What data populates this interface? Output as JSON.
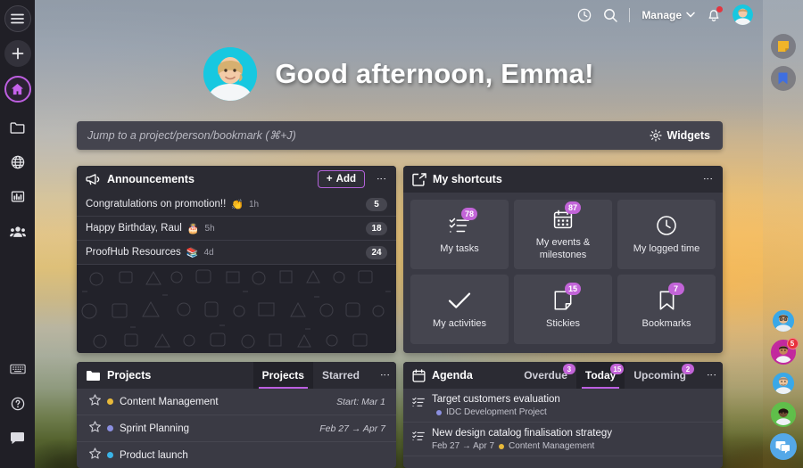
{
  "header": {
    "clock_icon": "clock-icon",
    "search_icon": "search-icon",
    "manage_label": "Manage",
    "chevron_icon": "chevron-down-icon",
    "bell_icon": "bell-icon",
    "avatar": "user-avatar"
  },
  "greeting": {
    "text": "Good afternoon, Emma!",
    "avatar": "emma-avatar"
  },
  "jumpbar": {
    "placeholder": "Jump to a project/person/bookmark (⌘+J)",
    "value": "",
    "widgets_label": "Widgets",
    "widgets_icon": "gear-icon"
  },
  "left_rail": {
    "items": [
      {
        "name": "menu-icon",
        "icon": "hamburger"
      },
      {
        "name": "add-icon",
        "icon": "plus"
      },
      {
        "name": "home-icon",
        "icon": "home",
        "active": true
      },
      {
        "name": "folder-icon",
        "icon": "folder"
      },
      {
        "name": "globe-icon",
        "icon": "globe"
      },
      {
        "name": "reports-icon",
        "icon": "chart"
      },
      {
        "name": "people-icon",
        "icon": "people"
      }
    ],
    "bottom_items": [
      {
        "name": "keyboard-icon",
        "icon": "keyboard"
      },
      {
        "name": "help-icon",
        "icon": "question"
      },
      {
        "name": "chat-icon",
        "icon": "chat"
      }
    ]
  },
  "right_rail": {
    "buttons": [
      {
        "name": "stickies-icon",
        "color": "#f0b429"
      },
      {
        "name": "bookmarks-icon",
        "color": "#3f6fe0"
      }
    ],
    "avatars": [
      {
        "name": "teammate-avatar-1",
        "ring": "none",
        "badge": ""
      },
      {
        "name": "teammate-avatar-2",
        "ring": "#c2289e",
        "badge": "5"
      },
      {
        "name": "teammate-avatar-3",
        "ring": "none",
        "badge": ""
      },
      {
        "name": "teammate-avatar-4",
        "ring": "#5fbf4a",
        "badge": ""
      }
    ],
    "chat_fab": "chat-bubble-icon"
  },
  "announcements": {
    "title": "Announcements",
    "icon": "megaphone-icon",
    "add_label": "Add",
    "menu_icon": "kebab-menu-icon",
    "rows": [
      {
        "text": "Congratulations on promotion!!",
        "emoji": "👏",
        "time": "1h",
        "count": "5"
      },
      {
        "text": "Happy Birthday, Raul",
        "emoji": "🎂",
        "time": "5h",
        "count": "18"
      },
      {
        "text": "ProofHub Resources",
        "emoji": "📚",
        "time": "4d",
        "count": "24"
      }
    ]
  },
  "shortcuts": {
    "title": "My shortcuts",
    "icon": "share-box-icon",
    "menu_icon": "kebab-menu-icon",
    "tiles": [
      {
        "label": "My tasks",
        "badge": "78",
        "icon": "checklist-icon"
      },
      {
        "label": "My events & milestones",
        "badge": "87",
        "icon": "calendar-icon"
      },
      {
        "label": "My logged time",
        "badge": "",
        "icon": "clock-icon"
      },
      {
        "label": "My activities",
        "badge": "",
        "icon": "check-icon"
      },
      {
        "label": "Stickies",
        "badge": "15",
        "icon": "note-icon"
      },
      {
        "label": "Bookmarks",
        "badge": "7",
        "icon": "bookmark-icon"
      }
    ]
  },
  "projects": {
    "title": "Projects",
    "icon": "folder-icon",
    "menu_icon": "kebab-menu-icon",
    "tabs": [
      {
        "label": "Projects",
        "active": true
      },
      {
        "label": "Starred",
        "active": false
      }
    ],
    "rows": [
      {
        "name": "Content Management",
        "color": "#e8b93a",
        "date": "Start: Mar 1"
      },
      {
        "name": "Sprint Planning",
        "color": "#8b8fe0",
        "date": "Feb 27 → Apr 7"
      },
      {
        "name": "Product launch",
        "color": "#3ab4e8",
        "date": ""
      }
    ]
  },
  "agenda": {
    "title": "Agenda",
    "icon": "calendar-icon",
    "menu_icon": "kebab-menu-icon",
    "tabs": [
      {
        "label": "Overdue",
        "badge": "3",
        "active": false
      },
      {
        "label": "Today",
        "badge": "15",
        "active": true
      },
      {
        "label": "Upcoming",
        "badge": "2",
        "active": false
      }
    ],
    "rows": [
      {
        "title": "Target customers evaluation",
        "dates": "",
        "project": "IDC Development Project",
        "color": "#8b8fe0",
        "icon": "task-list-icon"
      },
      {
        "title": "New design catalog finalisation strategy",
        "dates": "Feb 27 → Apr 7",
        "project": "Content Management",
        "color": "#e8b93a",
        "icon": "task-list-icon"
      }
    ]
  },
  "theme": {
    "accent": "#bb5fe0",
    "badge": "#c264d8",
    "panel_bg": "#3a3a44",
    "panel_head": "#2b2b33",
    "danger": "#e8303b"
  }
}
